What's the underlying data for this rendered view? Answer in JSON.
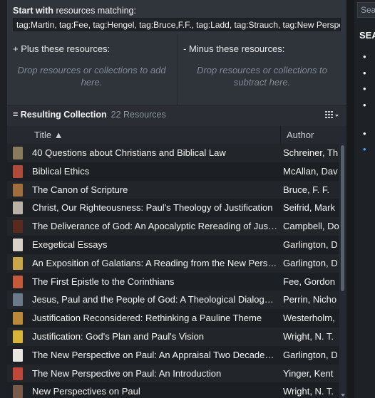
{
  "collection": {
    "start_label_bold": "Start with",
    "start_label_rest": "resources matching:",
    "query": "tag:Martin, tag:Fee, tag:Hengel, tag:Bruce,F.F., tag:Ladd, tag:Strauch, tag:New Perspective",
    "plus": {
      "title": "+ Plus these resources:",
      "hint": "Drop resources or collections to add here."
    },
    "minus": {
      "title": "- Minus these resources:",
      "hint": "Drop resources or collections to subtract here."
    },
    "result_label": "= Resulting Collection",
    "result_count": "22 Resources",
    "columns": {
      "title": "Title ▲",
      "author": "Author"
    },
    "rows": [
      {
        "title": "40 Questions about Christians and Biblical Law",
        "author": "Schreiner, Th",
        "color": "#8a7a5e"
      },
      {
        "title": "Biblical Ethics",
        "author": "McAllan, Dav",
        "color": "#b04a3a"
      },
      {
        "title": "The Canon of Scripture",
        "author": "Bruce, F. F.",
        "color": "#a06d3c"
      },
      {
        "title": "Christ, Our Righteousness: Paul's Theology of Justification",
        "author": "Seifrid, Mark",
        "color": "#b8b2a6"
      },
      {
        "title": "The Deliverance of God: An Apocalyptic Rereading of Justifica",
        "author": "Campbell, Do",
        "color": "#5a2a1e"
      },
      {
        "title": "Exegetical Essays",
        "author": "Garlington, D",
        "color": "#d6d2c8"
      },
      {
        "title": "An Exposition of Galatians: A Reading from the New Perspectiv",
        "author": "Garlington, D",
        "color": "#c9a64a"
      },
      {
        "title": "The First Epistle to the Corinthians",
        "author": "Fee, Gordon",
        "color": "#c45a3a"
      },
      {
        "title": "Jesus, Paul and the People of God: A Theological Dialogue wit",
        "author": "Perrin, Nicho",
        "color": "#6a7a8a"
      },
      {
        "title": "Justification Reconsidered: Rethinking a Pauline Theme",
        "author": "Westerholm,",
        "color": "#b88a3a"
      },
      {
        "title": "Justification: God's Plan and Paul's Vision",
        "author": "Wright, N. T.",
        "color": "#d8b43a"
      },
      {
        "title": "The New Perspective on Paul: An Appraisal Two Decades Later",
        "author": "Garlington, D",
        "color": "#e8e6e0"
      },
      {
        "title": "The New Perspective on Paul: An Introduction",
        "author": "Yinger, Kent",
        "color": "#c0483a"
      },
      {
        "title": "New Perspectives on Paul",
        "author": "Wright, N. T.",
        "color": "#7a5a4a"
      }
    ]
  },
  "side": {
    "search_placeholder": "Sear",
    "heading": "SEA",
    "bullets": [
      "•",
      "•",
      "•",
      "•",
      "•",
      "•"
    ]
  }
}
